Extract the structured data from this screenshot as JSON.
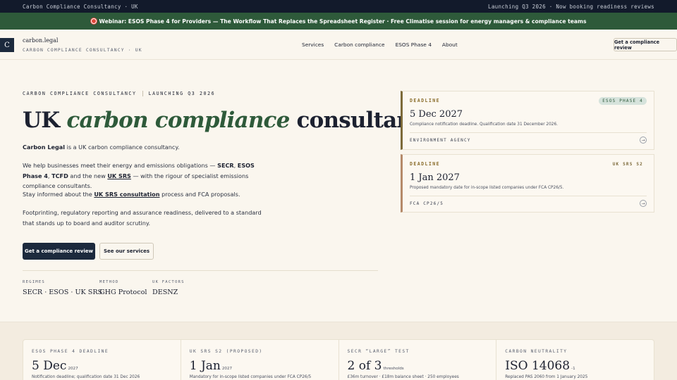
{
  "topbar": {
    "left": "Carbon Compliance Consultancy · UK",
    "right": "Launching Q3 2026 · Now booking readiness reviews"
  },
  "banner": {
    "text": "Webinar: ESOS Phase 4 for Providers — The Workflow That Replaces the Spreadsheet Register · Free Climatise session for energy managers & compliance teams"
  },
  "nav": {
    "logo_letter": "C",
    "logo_name": "carbon.legal",
    "logo_sub": "CARBON COMPLIANCE CONSULTANCY · UK",
    "links": [
      "Services",
      "Carbon compliance",
      "ESOS Phase 4",
      "About"
    ],
    "cta": "Get a compliance review"
  },
  "hero": {
    "eyebrow_left": "CARBON COMPLIANCE CONSULTANCY",
    "eyebrow_right": "LAUNCHING Q3 2026",
    "title_pre": "UK ",
    "title_em": "carbon compliance",
    "title_post": " consultancy",
    "p1_bold": "Carbon Legal",
    "p1_rest": " is a UK carbon compliance consultancy.",
    "p2_a": "We help businesses meet their energy and emissions obligations — ",
    "p2_secr": "SECR",
    "p2_comma1": ", ",
    "p2_esos": "ESOS Phase 4",
    "p2_comma2": ", ",
    "p2_tcfd": "TCFD",
    "p2_b": " and the new ",
    "p2_uksrs": "UK SRS",
    "p2_c": " — with the rigour of specialist emissions compliance consultants.",
    "p3_a": "Stay informed about the ",
    "p3_link": "UK SRS consultation",
    "p3_b": " process and FCA proposals.",
    "p4": "Footprinting, regulatory reporting and assurance readiness, delivered to a standard that stands up to board and auditor scrutiny.",
    "btn_primary": "Get a compliance review",
    "btn_secondary": "See our services",
    "stats": [
      {
        "label": "REGIMES",
        "value": "SECR · ESOS · UK SRS"
      },
      {
        "label": "METHOD",
        "value": "GHG Protocol"
      },
      {
        "label": "UK FACTORS",
        "value": "DESNZ"
      }
    ]
  },
  "deadlines": [
    {
      "label": "DEADLINE",
      "badge": "ESOS PHASE 4",
      "date": "5 Dec 2027",
      "desc": "Compliance notification deadline. Qualification date 31 December 2026.",
      "source": "ENVIRONMENT AGENCY",
      "arrow": "→"
    },
    {
      "label": "DEADLINE",
      "badge": "UK SRS S2",
      "date": "1 Jan 2027",
      "desc": "Proposed mandatory date for in-scope listed companies under FCA CP26/5.",
      "source": "FCA CP26/5",
      "arrow": "→"
    }
  ],
  "stat_cards": [
    {
      "title": "ESOS PHASE 4 DEADLINE",
      "big": "5 Dec",
      "small": "2027",
      "foot": "Notification deadline; qualification date 31 Dec 2026"
    },
    {
      "title": "UK SRS S2 (PROPOSED)",
      "big": "1 Jan",
      "small": "2027",
      "foot": "Mandatory for in-scope listed companies under FCA CP26/5"
    },
    {
      "title": "SECR “LARGE” TEST",
      "big": "2 of 3",
      "small": "thresholds",
      "foot": "£36m turnover · £18m balance sheet · 250 employees"
    },
    {
      "title": "CARBON NEUTRALITY",
      "big": "ISO 14068",
      "small": "-1",
      "foot": "Replaced PAS 2060 from 1 January 2025"
    }
  ],
  "colors": {
    "topbar": "#121a2b",
    "banner": "#2e5a3a",
    "accent_green": "#2e5a3a",
    "navy": "#1c2a3d",
    "deadline_gold": "#8a6d2c",
    "background": "#faf6ee"
  }
}
